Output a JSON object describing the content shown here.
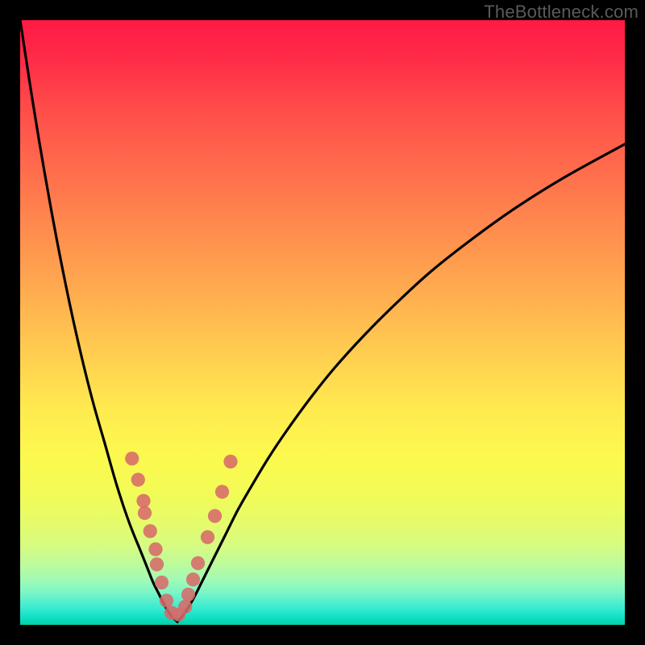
{
  "watermark": "TheBottleneck.com",
  "colors": {
    "frame": "#000000",
    "curve": "#000000",
    "marker_fill": "#d76a6a",
    "marker_stroke": "#d76a6a",
    "gradient_top": "#ff1a45",
    "gradient_bottom": "#06d2a4"
  },
  "chart_data": {
    "type": "line",
    "title": "",
    "xlabel": "",
    "ylabel": "",
    "xlim": [
      0,
      100
    ],
    "ylim": [
      0,
      100
    ],
    "grid": false,
    "legend": false,
    "note": "Two curves descending into a V near x≈25. x/y are percent of plot area; y=0 is top, y=100 is bottom (values below approach 100 at the valley).",
    "series": [
      {
        "name": "left-curve",
        "x": [
          0,
          2,
          4,
          6,
          8,
          10,
          12,
          14,
          16,
          18,
          20,
          21,
          22,
          23,
          24,
          25,
          26
        ],
        "y": [
          0,
          13,
          25,
          36,
          46,
          55,
          63,
          70,
          77,
          83,
          88,
          90.5,
          93,
          95,
          97,
          98.5,
          99.5
        ]
      },
      {
        "name": "right-curve",
        "x": [
          26,
          27,
          28,
          29,
          30,
          32,
          34,
          36,
          38,
          41,
          44,
          48,
          52,
          57,
          62,
          68,
          75,
          82,
          90,
          100
        ],
        "y": [
          99.5,
          98.3,
          96.8,
          95,
          93,
          89,
          85,
          81,
          77.5,
          72.5,
          68,
          62.5,
          57.5,
          52,
          47,
          41.5,
          36,
          31,
          26,
          20.5
        ]
      }
    ],
    "markers": {
      "name": "sample-points",
      "x": [
        18.5,
        19.5,
        20.4,
        20.6,
        21.5,
        22.4,
        22.6,
        23.4,
        24.2,
        25.0,
        26.2,
        27.3,
        27.8,
        28.6,
        29.4,
        31.0,
        32.2,
        33.4,
        34.8
      ],
      "y": [
        72.5,
        76.0,
        79.5,
        81.5,
        84.5,
        87.5,
        90.0,
        93.0,
        96.0,
        98.0,
        98.3,
        97.0,
        95.0,
        92.5,
        89.8,
        85.5,
        82.0,
        78.0,
        73.0
      ],
      "radius_pct": 1.15
    },
    "axes_visible": false
  }
}
